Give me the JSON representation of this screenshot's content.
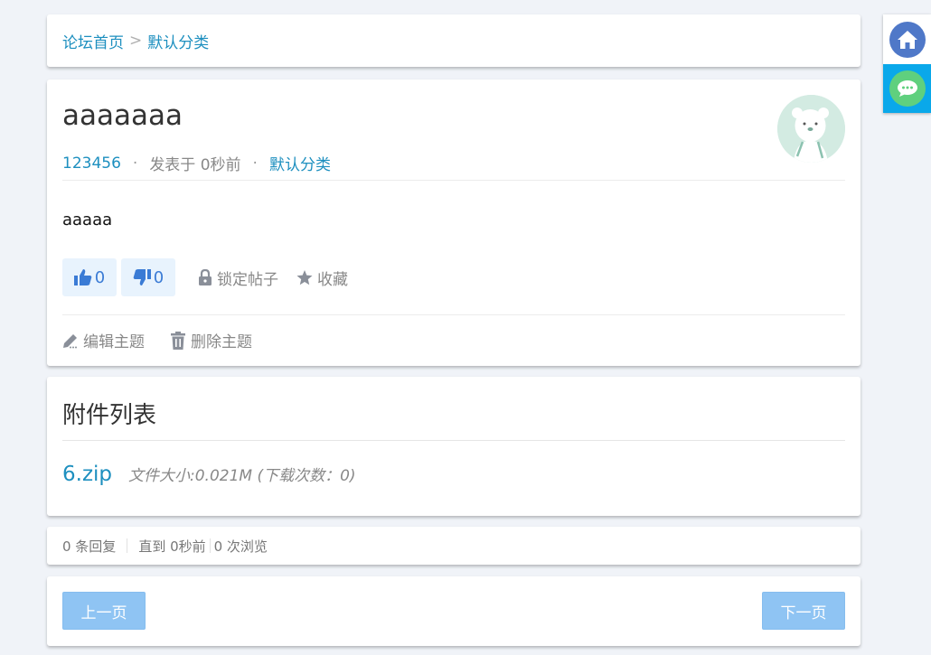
{
  "breadcrumb": {
    "home": "论坛首页",
    "separator": ">",
    "category": "默认分类"
  },
  "post": {
    "title": "aaaaaaa",
    "author": "123456",
    "dot": "·",
    "posted": "发表于 0秒前",
    "category": "默认分类",
    "content": "aaaaa",
    "likes": "0",
    "dislikes": "0",
    "lock_label": "锁定帖子",
    "favorite_label": "收藏",
    "edit_label": "编辑主题",
    "delete_label": "删除主题"
  },
  "attachments": {
    "heading": "附件列表",
    "files": [
      {
        "name": "6.zip",
        "info": "文件大小:0.021M (下载次数：0)"
      }
    ]
  },
  "stats": {
    "replies": "0 条回复",
    "last": "直到 0秒前",
    "views": "0 次浏览"
  },
  "pager": {
    "prev": "上一页",
    "next": "下一页"
  },
  "colors": {
    "link": "#1d8fbf",
    "accent": "#0aa8ea",
    "button": "#8fc4f3",
    "vote_bg": "#e8f3fd"
  },
  "icons": [
    "home-icon",
    "chat-icon",
    "thumbs-up-icon",
    "thumbs-down-icon",
    "lock-icon",
    "star-icon",
    "pencil-icon",
    "trash-icon"
  ]
}
